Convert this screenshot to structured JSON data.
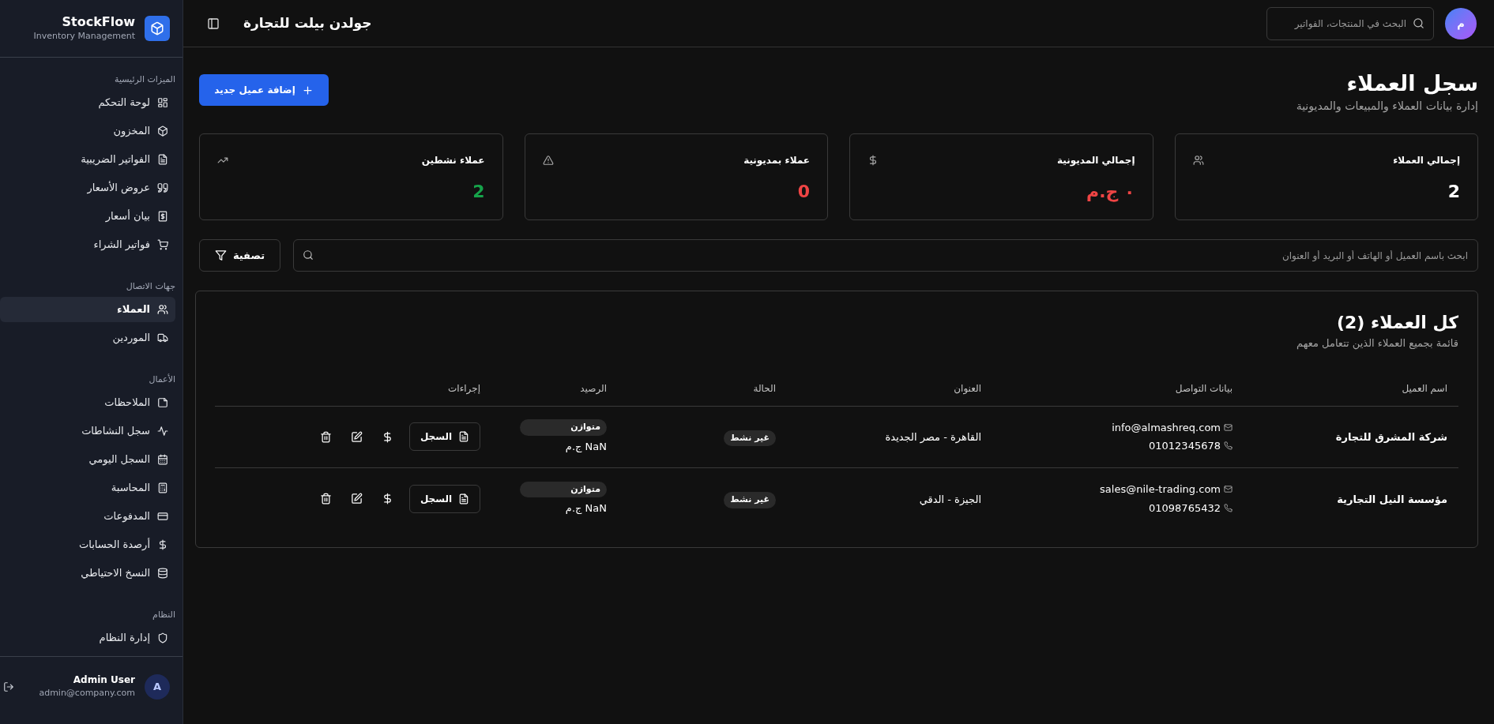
{
  "sidebar": {
    "brand": {
      "name": "StockFlow",
      "tagline": "Inventory Management"
    },
    "sections": [
      {
        "title": "الميزات الرئيسية",
        "items": [
          {
            "label": "لوحة التحكم",
            "selected": false
          },
          {
            "label": "المخزون",
            "selected": false
          },
          {
            "label": "الفواتير الضريبية",
            "selected": false
          },
          {
            "label": "عروض الأسعار",
            "selected": false
          },
          {
            "label": "بيان أسعار",
            "selected": false
          },
          {
            "label": "فواتير الشراء",
            "selected": false
          }
        ]
      },
      {
        "title": "جهات الاتصال",
        "items": [
          {
            "label": "العملاء",
            "selected": true
          },
          {
            "label": "الموردين",
            "selected": false
          }
        ]
      },
      {
        "title": "الأعمال",
        "items": [
          {
            "label": "الملاحظات",
            "selected": false
          },
          {
            "label": "سجل النشاطات",
            "selected": false
          },
          {
            "label": "السجل اليومي",
            "selected": false
          },
          {
            "label": "المحاسبة",
            "selected": false
          },
          {
            "label": "المدفوعات",
            "selected": false
          },
          {
            "label": "أرصدة الحسابات",
            "selected": false
          },
          {
            "label": "النسخ الاحتياطي",
            "selected": false
          }
        ]
      },
      {
        "title": "النظام",
        "items": [
          {
            "label": "إدارة النظام",
            "selected": false
          }
        ]
      }
    ],
    "user": {
      "name": "Admin User",
      "email": "admin@company.com",
      "initial": "A"
    }
  },
  "topbar": {
    "title": "جولدن بيلت للتجارة",
    "search_placeholder": "البحث في المنتجات، الفواتير",
    "avatar": "م"
  },
  "header": {
    "title": "سجل العملاء",
    "subtitle": "إدارة بيانات العملاء والمبيعات والمديونية",
    "add_button": "إضافة عميل جديد"
  },
  "stats": [
    {
      "label": "إجمالي العملاء",
      "value": "2",
      "color": "#ffffff"
    },
    {
      "label": "إجمالي المديونية",
      "value": "٠ ج.م",
      "color": "#ef4444"
    },
    {
      "label": "عملاء بمديونية",
      "value": "0",
      "color": "#ef4444"
    },
    {
      "label": "عملاء نشطين",
      "value": "2",
      "color": "#16a34a"
    }
  ],
  "filter": {
    "search_placeholder": "ابحث باسم العميل أو الهاتف أو البريد أو العنوان",
    "filter_button": "تصفية"
  },
  "table": {
    "title": "كل العملاء (2)",
    "subtitle": "قائمة بجميع العملاء الذين تتعامل معهم",
    "columns": [
      "اسم العميل",
      "بيانات التواصل",
      "العنوان",
      "الحالة",
      "الرصيد",
      "إجراءات"
    ],
    "rows": [
      {
        "name": "شركة المشرق للتجارة",
        "email": "info@almashreq.com",
        "phone": "01012345678",
        "address": "القاهرة - مصر الجديدة",
        "status": "غير نشط",
        "balance_state": "متوازن",
        "balance": "NaN ج.م",
        "log_button": "السجل"
      },
      {
        "name": "مؤسسة النيل التجارية",
        "email": "sales@nile-trading.com",
        "phone": "01098765432",
        "address": "الجيزة - الدقي",
        "status": "غير نشط",
        "balance_state": "متوازن",
        "balance": "NaN ج.م",
        "log_button": "السجل"
      }
    ]
  }
}
